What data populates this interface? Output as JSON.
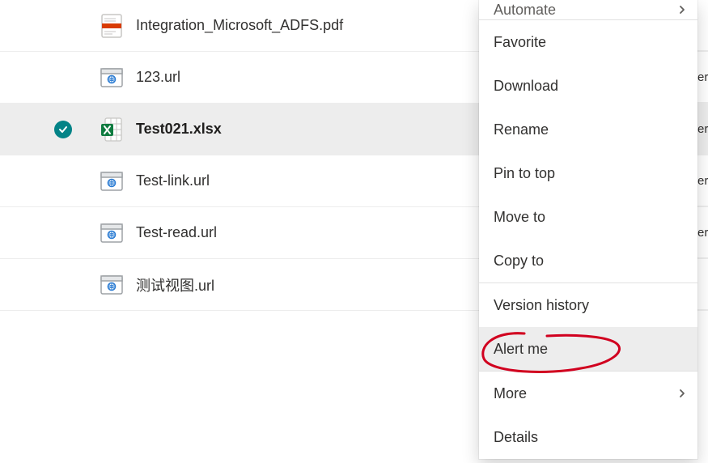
{
  "files": [
    {
      "name": "Integration_Microsoft_ADFS.pdf",
      "iconType": "pdf",
      "selected": false,
      "partial": ""
    },
    {
      "name": "123.url",
      "iconType": "url",
      "selected": false,
      "partial": "er"
    },
    {
      "name": "Test021.xlsx",
      "iconType": "xlsx",
      "selected": true,
      "partial": "er"
    },
    {
      "name": "Test-link.url",
      "iconType": "url",
      "selected": false,
      "partial": "er"
    },
    {
      "name": "Test-read.url",
      "iconType": "url",
      "selected": false,
      "partial": "er"
    },
    {
      "name": "测试视图.url",
      "iconType": "url",
      "selected": false,
      "partial": ""
    }
  ],
  "contextMenu": {
    "topPartial": "Automate",
    "items": [
      {
        "label": "Favorite",
        "chevron": false,
        "hovered": false,
        "sepAfter": false
      },
      {
        "label": "Download",
        "chevron": false,
        "hovered": false,
        "sepAfter": false
      },
      {
        "label": "Rename",
        "chevron": false,
        "hovered": false,
        "sepAfter": false
      },
      {
        "label": "Pin to top",
        "chevron": false,
        "hovered": false,
        "sepAfter": false
      },
      {
        "label": "Move to",
        "chevron": false,
        "hovered": false,
        "sepAfter": false
      },
      {
        "label": "Copy to",
        "chevron": false,
        "hovered": false,
        "sepAfter": true
      },
      {
        "label": "Version history",
        "chevron": false,
        "hovered": false,
        "sepAfter": false
      },
      {
        "label": "Alert me",
        "chevron": false,
        "hovered": true,
        "sepAfter": true
      },
      {
        "label": "More",
        "chevron": true,
        "hovered": false,
        "sepAfter": false
      },
      {
        "label": "Details",
        "chevron": false,
        "hovered": false,
        "sepAfter": false
      }
    ]
  },
  "annotation": {
    "stroke": "#d1001f"
  }
}
